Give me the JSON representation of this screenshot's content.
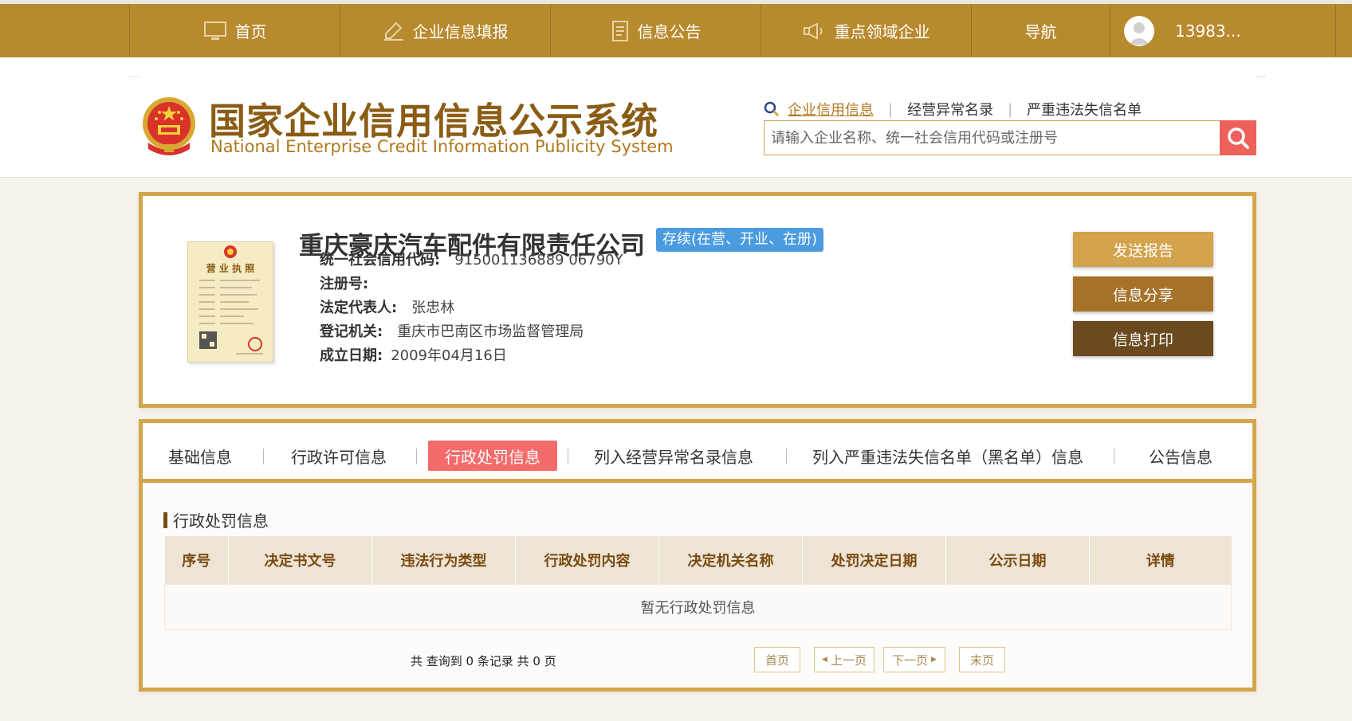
{
  "nav": {
    "items": [
      {
        "label": "首页",
        "icon": "monitor-icon"
      },
      {
        "label": "企业信息填报",
        "icon": "edit-icon"
      },
      {
        "label": "信息公告",
        "icon": "document-icon"
      },
      {
        "label": "重点领域企业",
        "icon": "megaphone-icon"
      },
      {
        "label": "导航",
        "icon": ""
      }
    ],
    "user_phone": "13983..."
  },
  "header": {
    "brand_cn": "国家企业信用信息公示系统",
    "brand_en": "National Enterprise Credit Information Publicity System",
    "links": [
      "企业信用信息",
      "经营异常名录",
      "严重违法失信名单"
    ],
    "search_placeholder": "请输入企业名称、统一社会信用代码或注册号"
  },
  "company": {
    "name": "重庆豪庆汽车配件有限责任公司",
    "status": "存续(在营、开业、在册)",
    "license_title": "营 业 执 照",
    "fields": [
      {
        "key": "统一社会信用代码:",
        "value": "915001136889 06790Y"
      },
      {
        "key": "注册号:",
        "value": ""
      },
      {
        "key": "法定代表人:",
        "value": "张忠林"
      },
      {
        "key": "登记机关:",
        "value": "重庆市巴南区市场监督管理局"
      },
      {
        "key": "成立日期:",
        "value": "2009年04月16日"
      }
    ],
    "buttons": [
      "发送报告",
      "信息分享",
      "信息打印"
    ]
  },
  "tabs": {
    "items": [
      "基础信息",
      "行政许可信息",
      "行政处罚信息",
      "列入经营异常名录信息",
      "列入严重违法失信名单（黑名单）信息",
      "公告信息"
    ],
    "active_index": 2
  },
  "penalty": {
    "title": "行政处罚信息",
    "columns": [
      "序号",
      "决定书文号",
      "违法行为类型",
      "行政处罚内容",
      "决定机关名称",
      "处罚决定日期",
      "公示日期",
      "详情"
    ],
    "empty_text": "暂无行政处罚信息",
    "pager": {
      "summary": "共 查询到 0 条记录 共 0 页",
      "first": "首页",
      "prev": "上一页",
      "next": "下一页",
      "last": "末页"
    }
  },
  "colors": {
    "nav_bg": "#b88a2e",
    "border_gold": "#d2a64a",
    "active_tab": "#f36b6b",
    "status_blue": "#4a9be0",
    "btn_send": "#d4a34e",
    "btn_share": "#a6722a",
    "btn_print": "#6a4a1e"
  }
}
